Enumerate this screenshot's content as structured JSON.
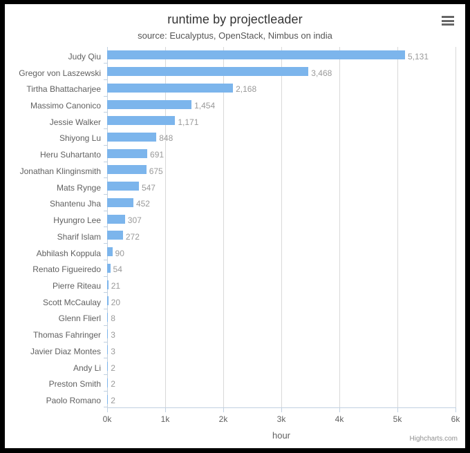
{
  "header": {
    "title": "runtime by projectleader",
    "subtitle": "source: Eucalyptus, OpenStack, Nimbus on india",
    "context_menu_icon": "hamburger-menu-icon"
  },
  "credits": {
    "text": "Highcharts.com"
  },
  "chart_data": {
    "type": "bar",
    "title": "runtime by projectleader",
    "subtitle": "source: Eucalyptus, OpenStack, Nimbus on india",
    "xlabel": "hour",
    "ylabel": "",
    "orientation": "horizontal",
    "grid": true,
    "legend": false,
    "xlim": [
      0,
      6000
    ],
    "x_tick_labels": [
      "0k",
      "1k",
      "2k",
      "3k",
      "4k",
      "5k",
      "6k"
    ],
    "x_tick_values": [
      0,
      1000,
      2000,
      3000,
      4000,
      5000,
      6000
    ],
    "series_color": "#7cb5ec",
    "categories": [
      "Judy Qiu",
      "Gregor von Laszewski",
      "Tirtha Bhattacharjee",
      "Massimo Canonico",
      "Jessie Walker",
      "Shiyong Lu",
      "Heru Suhartanto",
      "Jonathan Klinginsmith",
      "Mats Rynge",
      "Shantenu Jha",
      "Hyungro Lee",
      "Sharif Islam",
      "Abhilash Koppula",
      "Renato Figueiredo",
      "Pierre Riteau",
      "Scott McCaulay",
      "Glenn Flierl",
      "Thomas Fahringer",
      "Javier Diaz Montes",
      "Andy Li",
      "Preston Smith",
      "Paolo Romano"
    ],
    "values": [
      5131,
      3468,
      2168,
      1454,
      1171,
      848,
      691,
      675,
      547,
      452,
      307,
      272,
      90,
      54,
      21,
      20,
      8,
      3,
      3,
      2,
      2,
      2
    ],
    "value_labels": [
      "5,131",
      "3,468",
      "2,168",
      "1,454",
      "1,171",
      "848",
      "691",
      "675",
      "547",
      "452",
      "307",
      "272",
      "90",
      "54",
      "21",
      "20",
      "8",
      "3",
      "3",
      "2",
      "2",
      "2"
    ]
  }
}
